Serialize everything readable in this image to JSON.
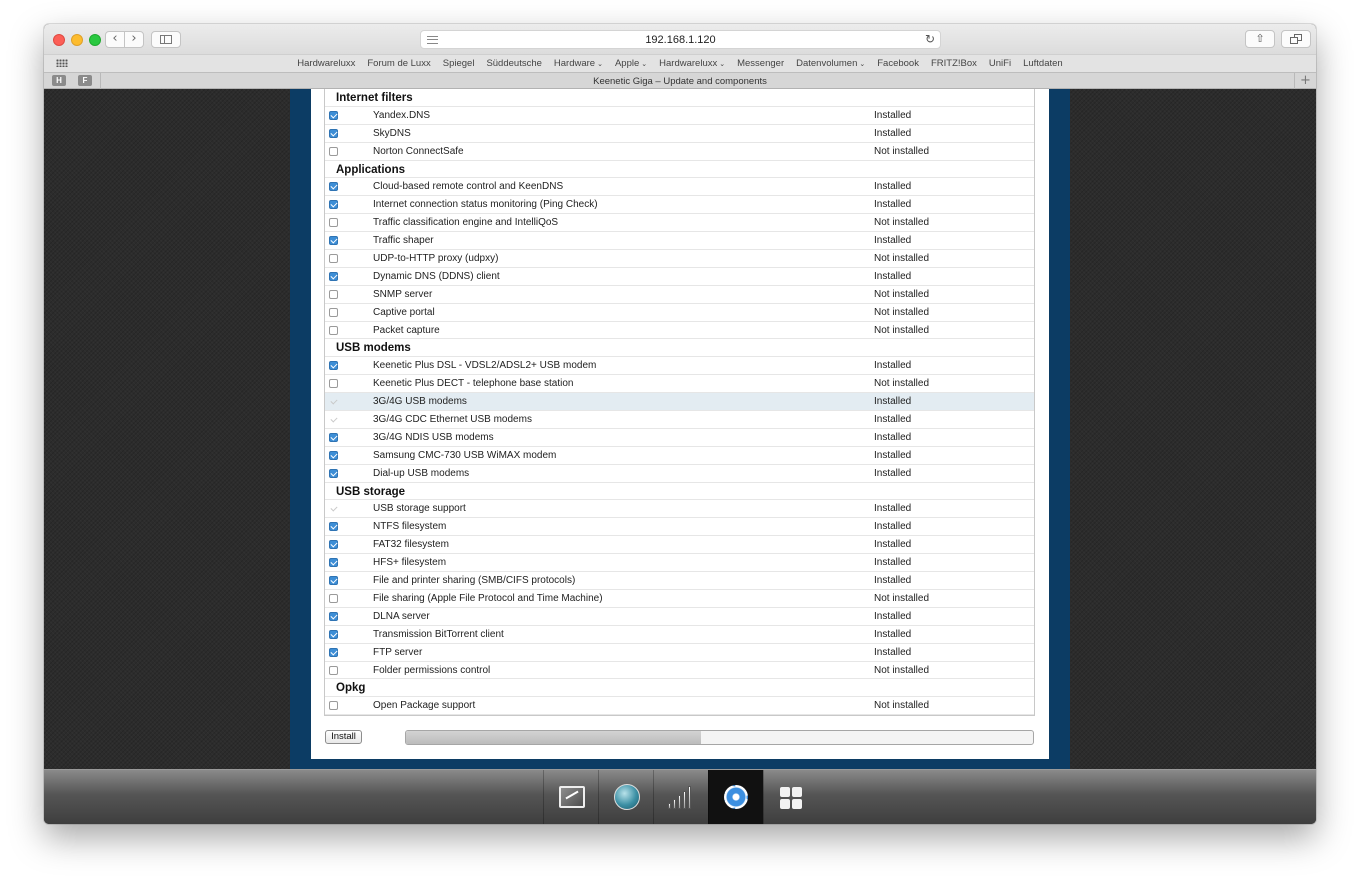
{
  "browser": {
    "url": "192.168.1.120",
    "tab_title": "Keenetic Giga – Update and components",
    "pinned_tabs": [
      "H",
      "F"
    ],
    "favorites": [
      {
        "label": "Hardwareluxx",
        "menu": false
      },
      {
        "label": "Forum de Luxx",
        "menu": false
      },
      {
        "label": "Spiegel",
        "menu": false
      },
      {
        "label": "Süddeutsche",
        "menu": false
      },
      {
        "label": "Hardware",
        "menu": true
      },
      {
        "label": "Apple",
        "menu": true
      },
      {
        "label": "Hardwareluxx",
        "menu": true
      },
      {
        "label": "Messenger",
        "menu": false
      },
      {
        "label": "Datenvolumen",
        "menu": true
      },
      {
        "label": "Facebook",
        "menu": false
      },
      {
        "label": "FRITZ!Box",
        "menu": false
      },
      {
        "label": "UniFi",
        "menu": false
      },
      {
        "label": "Luftdaten",
        "menu": false
      }
    ],
    "new_tab_glyph": "+"
  },
  "components": {
    "sections": [
      {
        "title": "Internet filters",
        "items": [
          {
            "name": "Yandex.DNS",
            "status": "Installed",
            "check": "checked"
          },
          {
            "name": "SkyDNS",
            "status": "Installed",
            "check": "checked"
          },
          {
            "name": "Norton ConnectSafe",
            "status": "Not installed",
            "check": "unchecked"
          }
        ]
      },
      {
        "title": "Applications",
        "items": [
          {
            "name": "Cloud-based remote control and KeenDNS",
            "status": "Installed",
            "check": "checked"
          },
          {
            "name": "Internet connection status monitoring (Ping Check)",
            "status": "Installed",
            "check": "checked"
          },
          {
            "name": "Traffic classification engine and IntelliQoS",
            "status": "Not installed",
            "check": "unchecked"
          },
          {
            "name": "Traffic shaper",
            "status": "Installed",
            "check": "checked"
          },
          {
            "name": "UDP-to-HTTP proxy (udpxy)",
            "status": "Not installed",
            "check": "unchecked"
          },
          {
            "name": "Dynamic DNS (DDNS) client",
            "status": "Installed",
            "check": "checked"
          },
          {
            "name": "SNMP server",
            "status": "Not installed",
            "check": "unchecked"
          },
          {
            "name": "Captive portal",
            "status": "Not installed",
            "check": "unchecked"
          },
          {
            "name": "Packet capture",
            "status": "Not installed",
            "check": "unchecked"
          }
        ]
      },
      {
        "title": "USB modems",
        "items": [
          {
            "name": "Keenetic Plus DSL - VDSL2/ADSL2+ USB modem",
            "status": "Installed",
            "check": "checked"
          },
          {
            "name": "Keenetic Plus DECT - telephone base station",
            "status": "Not installed",
            "check": "unchecked"
          },
          {
            "name": "3G/4G USB modems",
            "status": "Installed",
            "check": "disabled",
            "highlight": true
          },
          {
            "name": "3G/4G CDC Ethernet USB modems",
            "status": "Installed",
            "check": "disabled"
          },
          {
            "name": "3G/4G NDIS USB modems",
            "status": "Installed",
            "check": "checked"
          },
          {
            "name": "Samsung CMC-730 USB WiMAX modem",
            "status": "Installed",
            "check": "checked"
          },
          {
            "name": "Dial-up USB modems",
            "status": "Installed",
            "check": "checked"
          }
        ]
      },
      {
        "title": "USB storage",
        "items": [
          {
            "name": "USB storage support",
            "status": "Installed",
            "check": "disabled"
          },
          {
            "name": "NTFS filesystem",
            "status": "Installed",
            "check": "checked"
          },
          {
            "name": "FAT32 filesystem",
            "status": "Installed",
            "check": "checked"
          },
          {
            "name": "HFS+ filesystem",
            "status": "Installed",
            "check": "checked"
          },
          {
            "name": "File and printer sharing (SMB/CIFS protocols)",
            "status": "Installed",
            "check": "checked"
          },
          {
            "name": "File sharing (Apple File Protocol and Time Machine)",
            "status": "Not installed",
            "check": "unchecked"
          },
          {
            "name": "DLNA server",
            "status": "Installed",
            "check": "checked"
          },
          {
            "name": "Transmission BitTorrent client",
            "status": "Installed",
            "check": "checked"
          },
          {
            "name": "FTP server",
            "status": "Installed",
            "check": "checked"
          },
          {
            "name": "Folder permissions control",
            "status": "Not installed",
            "check": "unchecked"
          }
        ]
      },
      {
        "title": "Opkg",
        "items": [
          {
            "name": "Open Package support",
            "status": "Not installed",
            "check": "unchecked"
          }
        ]
      }
    ]
  },
  "footer": {
    "install_label": "Install",
    "progress": 0.47
  },
  "dock": {
    "items": [
      {
        "icon": "monitor-icon",
        "active": false
      },
      {
        "icon": "globe-icon",
        "active": false
      },
      {
        "icon": "signal-bars-icon",
        "active": false
      },
      {
        "icon": "gear-icon",
        "active": true
      },
      {
        "icon": "grid-icon",
        "active": false
      }
    ]
  },
  "colors": {
    "frame_blue": "#0c3c64",
    "checkbox_blue": "#3d8ed6",
    "row_highlight": "#e3ecf2"
  }
}
